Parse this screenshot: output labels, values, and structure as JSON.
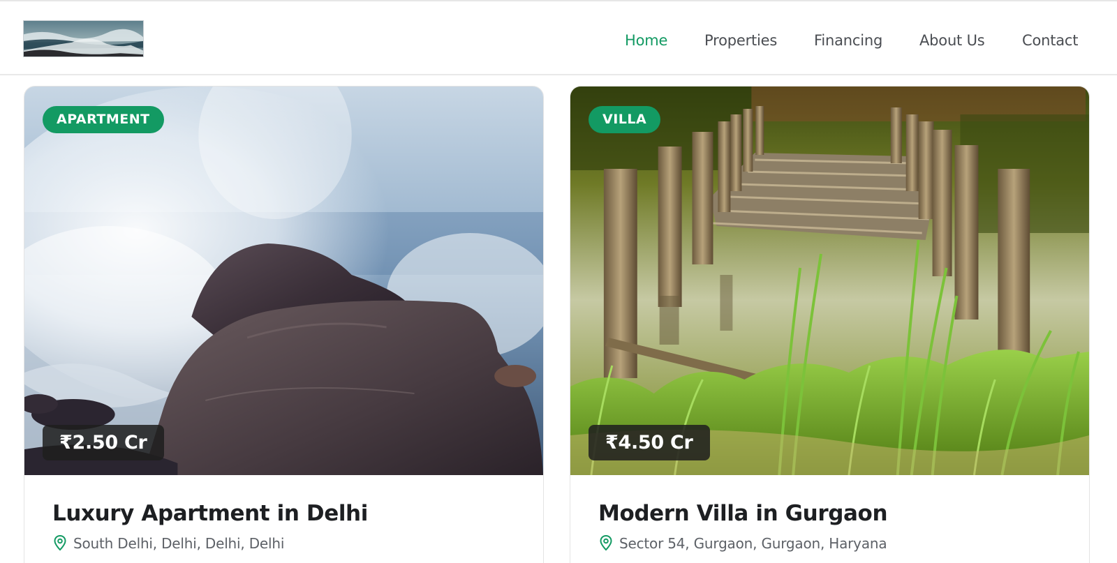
{
  "header": {
    "logo_icon": "landscape-photo-logo",
    "nav": [
      {
        "label": "Home",
        "active": true
      },
      {
        "label": "Properties",
        "active": false
      },
      {
        "label": "Financing",
        "active": false
      },
      {
        "label": "About Us",
        "active": false
      },
      {
        "label": "Contact",
        "active": false
      }
    ]
  },
  "listings": [
    {
      "type": "APARTMENT",
      "price": "₹2.50 Cr",
      "title": "Luxury Apartment in Delhi",
      "location": "South Delhi, Delhi, Delhi, Delhi",
      "image": "ocean-waves-on-rocks-photo"
    },
    {
      "type": "VILLA",
      "price": "₹4.50 Cr",
      "title": "Modern Villa in Gurgaon",
      "location": "Sector 54, Gurgaon, Gurgaon, Haryana",
      "image": "wooden-pier-in-pond-photo"
    }
  ],
  "colors": {
    "accent": "#139a63",
    "nav_text": "#4a4d52",
    "price_badge_bg": "#1e1e1e",
    "title_text": "#1d1f22",
    "location_text": "#5d6167"
  },
  "icons": {
    "location": "map-pin-icon"
  }
}
